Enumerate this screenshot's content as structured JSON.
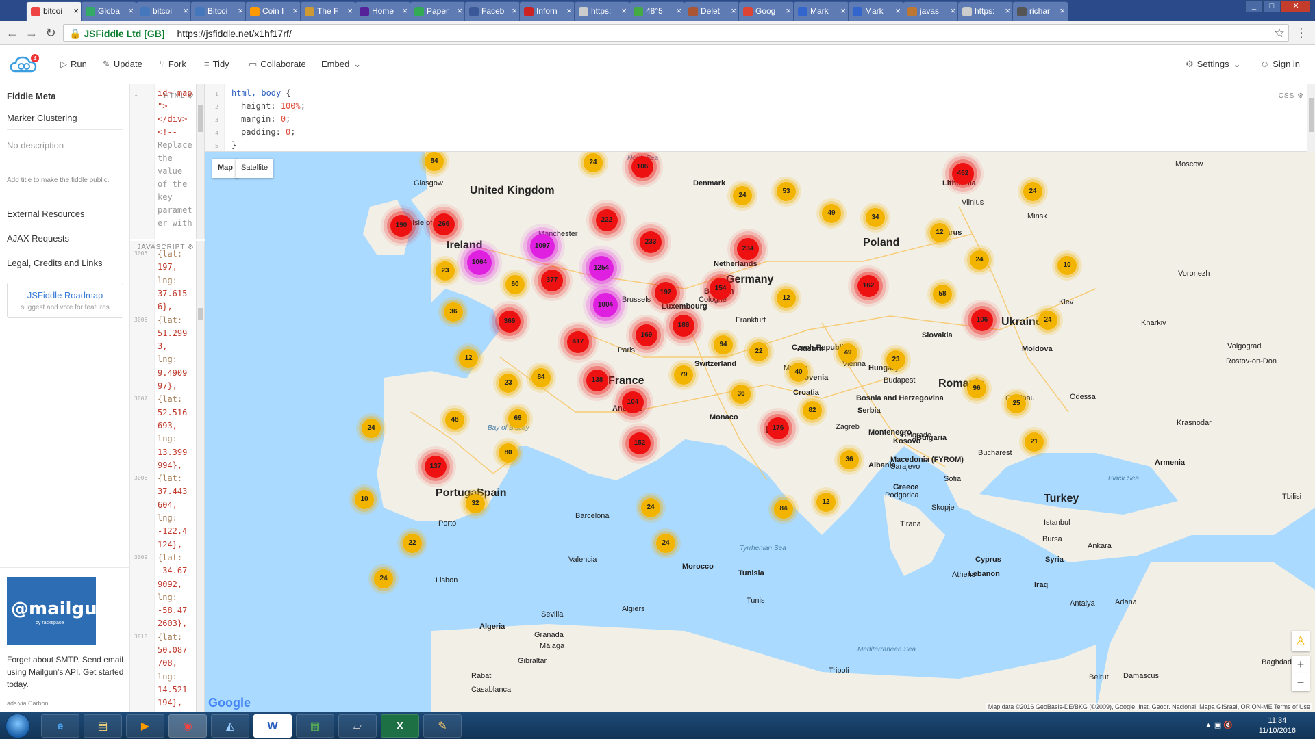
{
  "browser": {
    "tabs": [
      {
        "label": "bitcoi",
        "color": "#e44"
      },
      {
        "label": "Globa",
        "color": "#3a6"
      },
      {
        "label": "bitcoi",
        "color": "#47b"
      },
      {
        "label": "Bitcoi",
        "color": "#47b"
      },
      {
        "label": "Coin I",
        "color": "#f90"
      },
      {
        "label": "The F",
        "color": "#c93"
      },
      {
        "label": "Home",
        "color": "#529"
      },
      {
        "label": "Paper",
        "color": "#3a5"
      },
      {
        "label": "Faceb",
        "color": "#3b5998"
      },
      {
        "label": "Inforn",
        "color": "#c22"
      },
      {
        "label": "https:",
        "color": "#ccc"
      },
      {
        "label": "48°5",
        "color": "#4a4"
      },
      {
        "label": "Delet",
        "color": "#a53"
      },
      {
        "label": "Goog",
        "color": "#d43"
      },
      {
        "label": "Mark",
        "color": "#36c"
      },
      {
        "label": "Mark",
        "color": "#36c"
      },
      {
        "label": "javas",
        "color": "#b73"
      },
      {
        "label": "https:",
        "color": "#ccc"
      },
      {
        "label": "richar",
        "color": "#555"
      }
    ],
    "secure_label": "JSFiddle Ltd [GB]",
    "url": "https://jsfiddle.net/x1hf17rf/"
  },
  "header": {
    "run": "Run",
    "update": "Update",
    "fork": "Fork",
    "tidy": "Tidy",
    "collaborate": "Collaborate",
    "embed": "Embed",
    "settings": "Settings",
    "signin": "Sign in",
    "badge": "4"
  },
  "sidebar": {
    "meta": "Fiddle Meta",
    "title": "Marker Clustering",
    "description": "No description",
    "hint": "Add title to make the fiddle public.",
    "external": "External Resources",
    "ajax": "AJAX Requests",
    "legal": "Legal, Credits and Links",
    "roadmap_title": "JSFiddle Roadmap",
    "roadmap_sub": "suggest and vote for features",
    "ad_logo": "@mailgun",
    "ad_sub": "by rackspace",
    "ad_text": "Forget about SMTP. Send email using Mailgun's API. Get started today.",
    "ad_credit": "ads via Carbon"
  },
  "html_panel": {
    "label": "HTML",
    "lines": [
      "id= map",
      "\">",
      "</div>",
      "<!--",
      "Replace",
      "the",
      "value",
      "of the",
      "key",
      "paramet",
      "er with"
    ]
  },
  "js_panel": {
    "label": "JAVASCRIPT",
    "lines": [
      "{lat:",
      "197,",
      "lng:",
      "37.615",
      "6},",
      "{lat:",
      "51.299",
      "3,",
      "lng:",
      "9.4909",
      "97},",
      "{lat:",
      "52.516",
      "693,",
      "lng:",
      "13.399",
      "994},",
      "{lat:",
      "37.443",
      "604,",
      "lng:",
      "-122.4",
      "124},",
      "{lat:",
      "-34.67",
      "9092,",
      "lng:",
      "-58.47",
      "2603},",
      "{lat:",
      "50.087",
      "708,",
      "lng:",
      "14.521",
      "194},",
      "{lat:"
    ],
    "line_numbers": [
      "3005",
      "3006",
      "3007",
      "3008",
      "3009",
      "3010",
      "3011"
    ]
  },
  "css_panel": {
    "label": "CSS",
    "lines": [
      {
        "sel": "html, body",
        "brace": " {"
      },
      {
        "prop": "height:",
        "val": "100%",
        "end": ";"
      },
      {
        "prop": "margin:",
        "val": "0",
        "end": ";"
      },
      {
        "prop": "padding:",
        "val": "0",
        "end": ";"
      },
      {
        "brace": "}"
      }
    ]
  },
  "map": {
    "type_map": "Map",
    "type_satellite": "Satellite",
    "credit": "Map data ©2016 GeoBasis-DE/BKG (©2009), Google, Inst. Geogr. Nacional, Mapa GISrael, ORION-ME   Terms of Use",
    "logo": "Google",
    "zoom_in": "+",
    "zoom_out": "−",
    "countries": [
      "United Kingdom",
      "Ireland",
      "France",
      "Spain",
      "Portugal",
      "Italy",
      "Germany",
      "Poland",
      "Ukraine",
      "Romania",
      "Turkey",
      "Belarus",
      "Lithuania",
      "Greece",
      "Bulgaria",
      "Hungary",
      "Czech Republic",
      "Slovakia",
      "Switzerland",
      "Belgium",
      "Netherlands",
      "Denmark",
      "Austria",
      "Croatia",
      "Serbia",
      "Albania",
      "Moldova",
      "Morocco",
      "Tunisia",
      "Algeria",
      "Syria",
      "Iraq",
      "Armenia",
      "Cyprus",
      "Lebanon",
      "Slovenia",
      "Kosovo",
      "Montenegro",
      "Macedonia (FYROM)",
      "Bosnia and Herzegovina",
      "Andorra",
      "Monaco",
      "Luxembourg"
    ],
    "cities": [
      "Glasgow",
      "Isle of Man",
      "Manchester",
      "Paris",
      "Brussels",
      "Cologne",
      "Frankfurt",
      "Munich",
      "Vienna",
      "Budapest",
      "Belgrade",
      "Bucharest",
      "Sofia",
      "Kiev",
      "Kharkiv",
      "Odessa",
      "Minsk",
      "Vilnius",
      "Moscow",
      "Voronezh",
      "Volgograd",
      "Rostov-on-Don",
      "Krasnodar",
      "Istanbul",
      "Bursa",
      "Ankara",
      "Antalya",
      "Adana",
      "Athens",
      "Tirana",
      "Sarajevo",
      "Podgorica",
      "Skopje",
      "Valencia",
      "Barcelona",
      "Sevilla",
      "Granada",
      "Málaga",
      "Gibraltar",
      "Lisbon",
      "Porto",
      "Rabat",
      "Casablanca",
      "Algiers",
      "Tunis",
      "Tripoli",
      "Damascus",
      "Beirut",
      "Chisinau",
      "Zagreb",
      "Tbilisi",
      "Baghdad"
    ],
    "seas": [
      "North Sea",
      "Bay of Biscay",
      "Tyrrhenian Sea",
      "Black Sea",
      "Mediterranean Sea"
    ],
    "clusters": [
      {
        "v": "84",
        "c": "y"
      },
      {
        "v": "24",
        "c": "y"
      },
      {
        "v": "106",
        "c": "r"
      },
      {
        "v": "24",
        "c": "y"
      },
      {
        "v": "53",
        "c": "y"
      },
      {
        "v": "452",
        "c": "r"
      },
      {
        "v": "24",
        "c": "y"
      },
      {
        "v": "190",
        "c": "r"
      },
      {
        "v": "266",
        "c": "r"
      },
      {
        "v": "1097",
        "c": "p"
      },
      {
        "v": "222",
        "c": "r"
      },
      {
        "v": "233",
        "c": "r"
      },
      {
        "v": "49",
        "c": "y"
      },
      {
        "v": "34",
        "c": "y"
      },
      {
        "v": "12",
        "c": "y"
      },
      {
        "v": "1064",
        "c": "p"
      },
      {
        "v": "23",
        "c": "y"
      },
      {
        "v": "1254",
        "c": "p"
      },
      {
        "v": "234",
        "c": "r"
      },
      {
        "v": "24",
        "c": "y"
      },
      {
        "v": "10",
        "c": "y"
      },
      {
        "v": "60",
        "c": "y"
      },
      {
        "v": "377",
        "c": "r"
      },
      {
        "v": "192",
        "c": "r"
      },
      {
        "v": "154",
        "c": "r"
      },
      {
        "v": "162",
        "c": "r"
      },
      {
        "v": "58",
        "c": "y"
      },
      {
        "v": "36",
        "c": "y"
      },
      {
        "v": "1004",
        "c": "p"
      },
      {
        "v": "12",
        "c": "y"
      },
      {
        "v": "106",
        "c": "r"
      },
      {
        "v": "24",
        "c": "y"
      },
      {
        "v": "369",
        "c": "r"
      },
      {
        "v": "188",
        "c": "r"
      },
      {
        "v": "169",
        "c": "r"
      },
      {
        "v": "417",
        "c": "r"
      },
      {
        "v": "94",
        "c": "y"
      },
      {
        "v": "22",
        "c": "y"
      },
      {
        "v": "49",
        "c": "y"
      },
      {
        "v": "23",
        "c": "y"
      },
      {
        "v": "12",
        "c": "y"
      },
      {
        "v": "84",
        "c": "y"
      },
      {
        "v": "23",
        "c": "y"
      },
      {
        "v": "138",
        "c": "r"
      },
      {
        "v": "79",
        "c": "y"
      },
      {
        "v": "40",
        "c": "y"
      },
      {
        "v": "96",
        "c": "y"
      },
      {
        "v": "36",
        "c": "y"
      },
      {
        "v": "104",
        "c": "r"
      },
      {
        "v": "82",
        "c": "y"
      },
      {
        "v": "25",
        "c": "y"
      },
      {
        "v": "24",
        "c": "y"
      },
      {
        "v": "48",
        "c": "y"
      },
      {
        "v": "69",
        "c": "y"
      },
      {
        "v": "176",
        "c": "r"
      },
      {
        "v": "21",
        "c": "y"
      },
      {
        "v": "80",
        "c": "y"
      },
      {
        "v": "152",
        "c": "r"
      },
      {
        "v": "36",
        "c": "y"
      },
      {
        "v": "137",
        "c": "r"
      },
      {
        "v": "10",
        "c": "y"
      },
      {
        "v": "32",
        "c": "y"
      },
      {
        "v": "24",
        "c": "y"
      },
      {
        "v": "84",
        "c": "y"
      },
      {
        "v": "12",
        "c": "y"
      },
      {
        "v": "22",
        "c": "y"
      },
      {
        "v": "24",
        "c": "y"
      },
      {
        "v": "24",
        "c": "y"
      }
    ]
  },
  "taskbar": {
    "time": "11:34",
    "date": "11/10/2016"
  }
}
